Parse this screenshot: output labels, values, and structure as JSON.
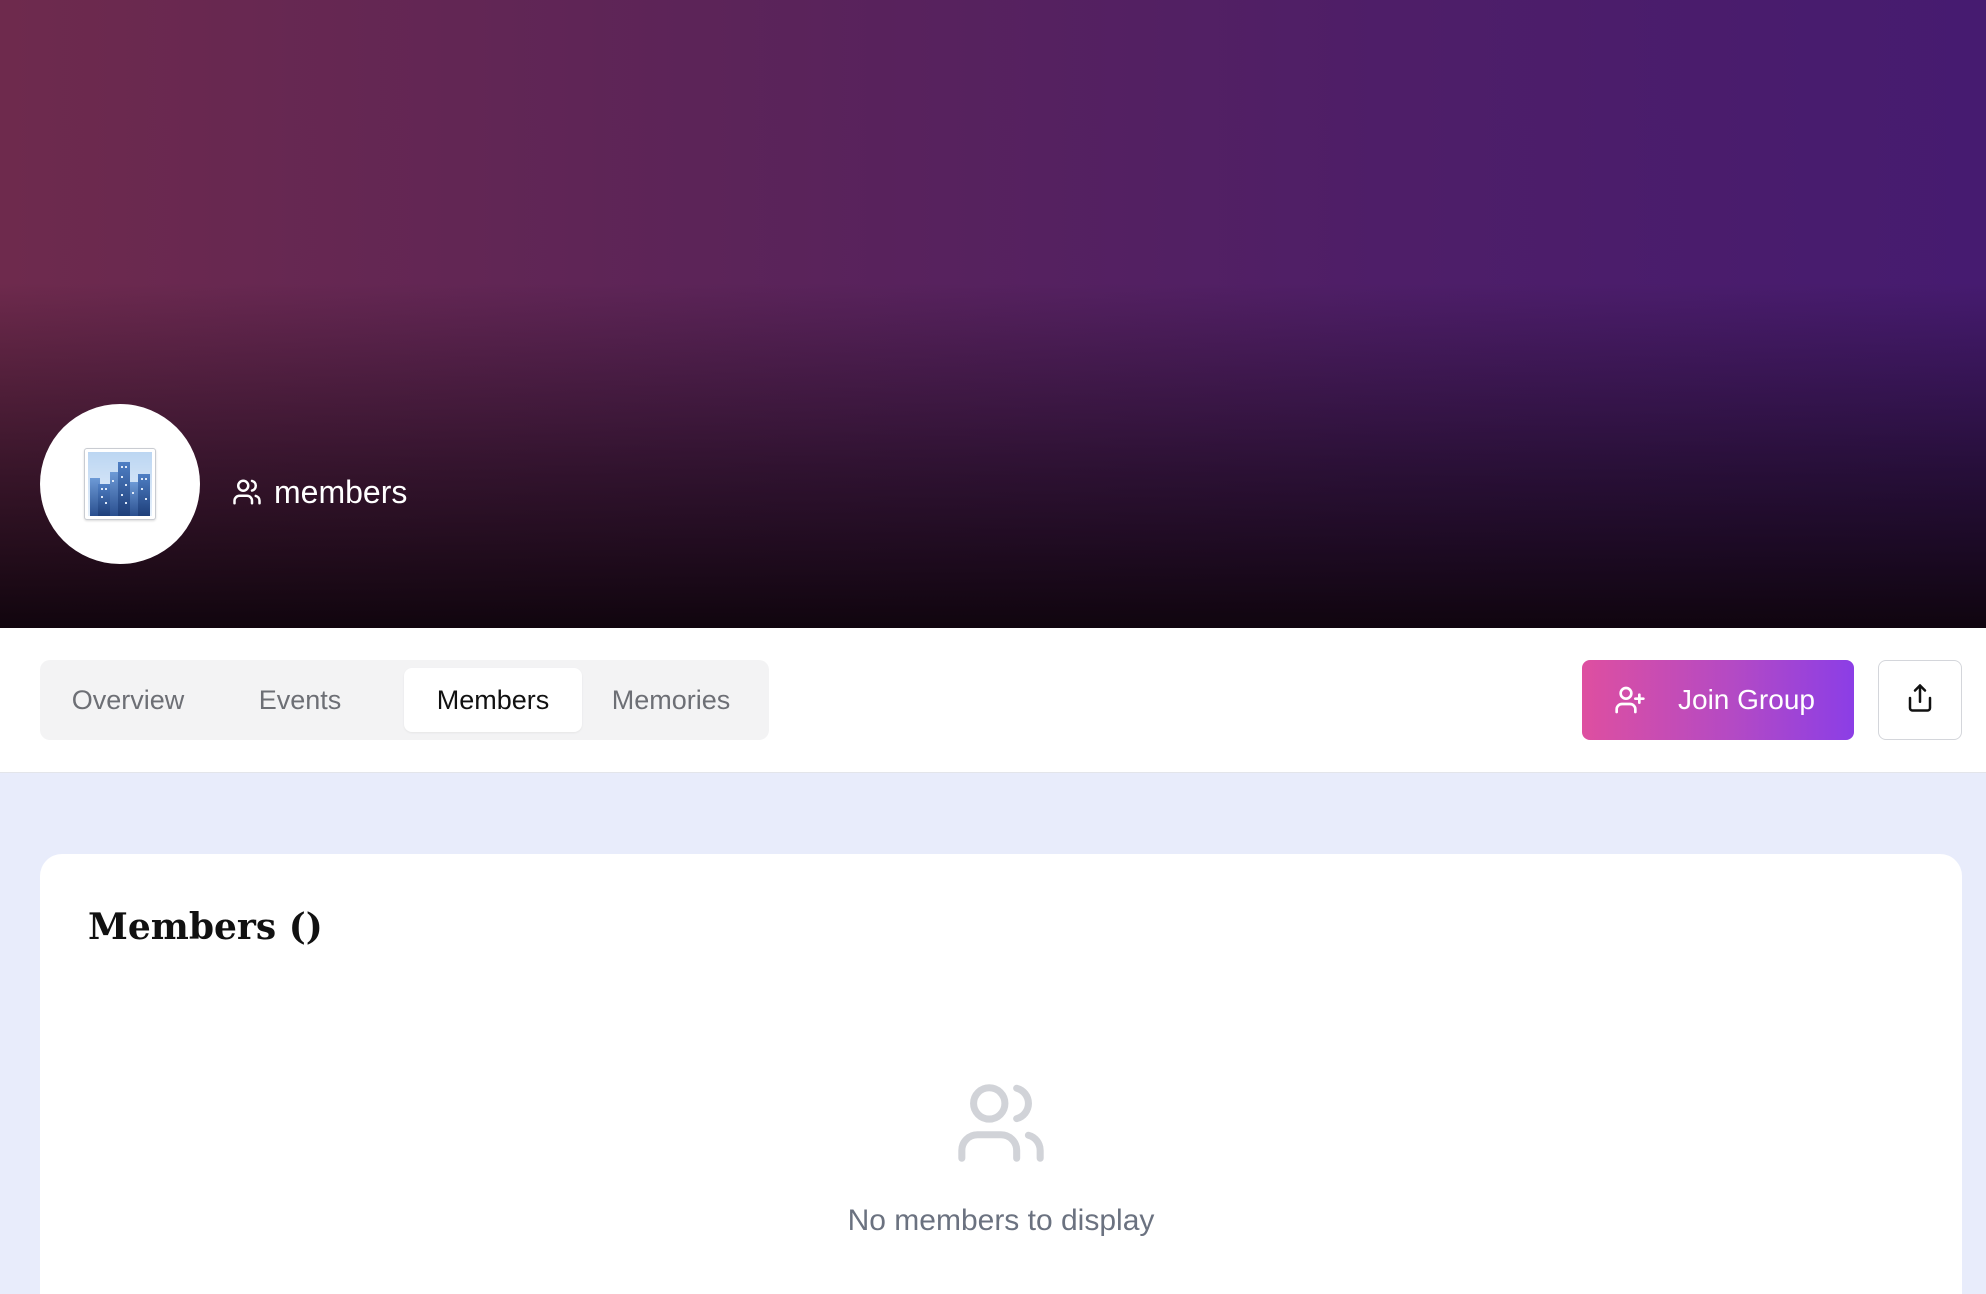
{
  "hero": {
    "avatar_icon": "cityscape-icon",
    "members_icon": "users-icon",
    "members_label": "members",
    "gradient_colors": [
      "#6e2a4d",
      "#461b70"
    ]
  },
  "tabs": [
    {
      "label": "Overview",
      "active": false
    },
    {
      "label": "Events",
      "active": false
    },
    {
      "label": "Members",
      "active": true
    },
    {
      "label": "Memories",
      "active": false
    }
  ],
  "actions": {
    "join_label": "Join Group",
    "join_icon": "user-plus-icon",
    "share_icon": "share-icon",
    "join_gradient": [
      "#de4fa0",
      "#8b3ee6"
    ]
  },
  "members_section": {
    "title": "Members ()",
    "empty_icon": "users-icon",
    "empty_text": "No members to display"
  }
}
